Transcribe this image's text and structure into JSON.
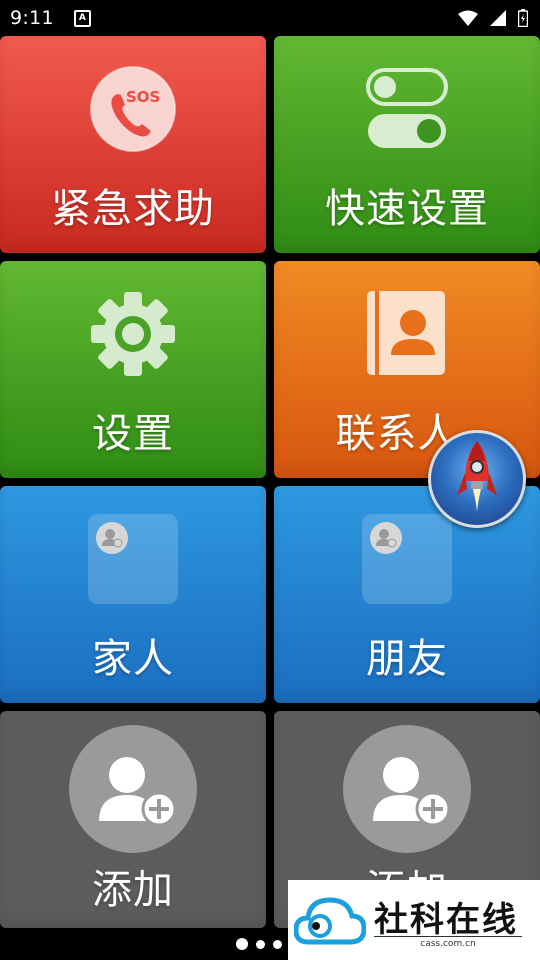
{
  "status": {
    "time": "9:11",
    "notif_icon_letter": "A"
  },
  "tiles": {
    "sos": {
      "label": "紧急求助",
      "badge": "SOS"
    },
    "quick_settings": {
      "label": "快速设置"
    },
    "settings": {
      "label": "设置"
    },
    "contacts": {
      "label": "联系人"
    },
    "family": {
      "label": "家人"
    },
    "friends": {
      "label": "朋友"
    },
    "add1": {
      "label": "添加"
    },
    "add2": {
      "label": "添加"
    }
  },
  "pager": {
    "pages": 3,
    "current": 1
  },
  "watermark": {
    "title": "社科在线",
    "domain": "cass.com.cn"
  },
  "colors": {
    "red": "#e5463a",
    "green": "#47a423",
    "orange": "#e8701a",
    "blue": "#2583d2",
    "gray": "#5c5c5c"
  }
}
